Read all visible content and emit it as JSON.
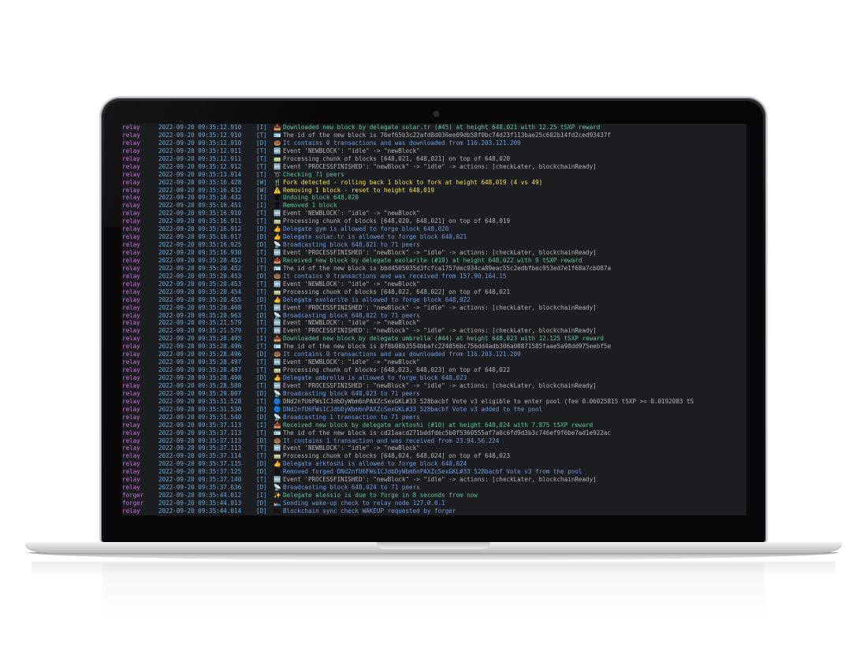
{
  "colors": {
    "process": "#c873d9",
    "timestamp": "#69a8d8",
    "msg_info": "#5fc29a",
    "msg_debug": "#6b9be0",
    "msg_trace": "#b0b3b8",
    "msg_warn": "#f1e05a"
  },
  "log_lines": [
    {
      "proc": "relay",
      "ts": "2022-09-20 09:35:12.910",
      "lvl": "[I]",
      "icon": "📥",
      "msg": "Downloaded new block by delegate solar.tr (#45) at height 648,021 with 12.25 tSXP reward",
      "color": "#5fc29a"
    },
    {
      "proc": "relay",
      "ts": "2022-09-20 09:35:12.910",
      "lvl": "[T]",
      "icon": "🪪",
      "msg": "The id of the new block is 76ef65b3c22afd8d036ee09db58f0bc74d23f113bae25c602b14fd2ced93437f",
      "color": "#b0b3b8"
    },
    {
      "proc": "relay",
      "ts": "2022-09-20 09:35:12.910",
      "lvl": "[D]",
      "icon": "🍩",
      "msg": "It contains 0 transactions and was downloaded from 116.203.121.209",
      "color": "#6b9be0"
    },
    {
      "proc": "relay",
      "ts": "2022-09-20 09:35:12.911",
      "lvl": "[T]",
      "icon": "🆕",
      "msg": "Event 'NEWBLOCK': \"idle\" -> \"newBlock\"",
      "color": "#b0b3b8"
    },
    {
      "proc": "relay",
      "ts": "2022-09-20 09:35:12.911",
      "lvl": "[T]",
      "icon": "🚃",
      "msg": "Processing chunk of blocks [648,021, 648,021] on top of 648,020",
      "color": "#b0b3b8"
    },
    {
      "proc": "relay",
      "ts": "2022-09-20 09:35:12.912",
      "lvl": "[T]",
      "icon": "🆕",
      "msg": "Event 'PROCESSFINISHED': \"newBlock\" -> \"idle\" -> actions: [checkLater, blockchainReady]",
      "color": "#b0b3b8"
    },
    {
      "proc": "relay",
      "ts": "2022-09-20 09:35:13.914",
      "lvl": "[T]",
      "icon": "➰",
      "msg": "Checking 71 peers",
      "color": "#5fc29a"
    },
    {
      "proc": "relay",
      "ts": "2022-09-20 09:35:16.428",
      "lvl": "[W]",
      "icon": "🍴",
      "msg": "Fork detected - rolling back 1 block to fork at height 648,019 (4 vs 49)",
      "color": "#f1e05a"
    },
    {
      "proc": "relay",
      "ts": "2022-09-20 09:35:16.432",
      "lvl": "[W]",
      "icon": "⚠️",
      "msg": "Removing 1 block - reset to height 648,019",
      "color": "#f1e05a"
    },
    {
      "proc": "relay",
      "ts": "2022-09-20 09:35:16.432",
      "lvl": "[I]",
      "icon": "🗑",
      "msg": "Undoing block 648,020",
      "color": "#5fc29a"
    },
    {
      "proc": "relay",
      "ts": "2022-09-20 09:35:16.451",
      "lvl": "[I]",
      "icon": "🗑",
      "msg": "Removed 1 block",
      "color": "#5fc29a"
    },
    {
      "proc": "relay",
      "ts": "2022-09-20 09:35:16.910",
      "lvl": "[T]",
      "icon": "🆕",
      "msg": "Event 'NEWBLOCK': \"idle\" -> \"newBlock\"",
      "color": "#b0b3b8"
    },
    {
      "proc": "relay",
      "ts": "2022-09-20 09:35:16.911",
      "lvl": "[T]",
      "icon": "🚃",
      "msg": "Processing chunk of blocks [648,020, 648,021] on top of 648,019",
      "color": "#b0b3b8"
    },
    {
      "proc": "relay",
      "ts": "2022-09-20 09:35:16.912",
      "lvl": "[D]",
      "icon": "👍",
      "msg": "Delegate gym is allowed to forge block 648,020",
      "color": "#6b9be0"
    },
    {
      "proc": "relay",
      "ts": "2022-09-20 09:35:16.917",
      "lvl": "[D]",
      "icon": "👍",
      "msg": "Delegate solar.tr is allowed to forge block 648,021",
      "color": "#6b9be0"
    },
    {
      "proc": "relay",
      "ts": "2022-09-20 09:35:16.925",
      "lvl": "[D]",
      "icon": "📡",
      "msg": "Broadcasting block 648,021 to 71 peers",
      "color": "#6b9be0"
    },
    {
      "proc": "relay",
      "ts": "2022-09-20 09:35:16.930",
      "lvl": "[T]",
      "icon": "🆕",
      "msg": "Event 'PROCESSFINISHED': \"newBlock\" -> \"idle\" -> actions: [checkLater, blockchainReady]",
      "color": "#b0b3b8"
    },
    {
      "proc": "relay",
      "ts": "2022-09-20 09:35:20.452",
      "lvl": "[I]",
      "icon": "📥",
      "msg": "Received new block by delegate exolarite (#19) at height 648,022 with 9 tSXP reward",
      "color": "#5fc29a"
    },
    {
      "proc": "relay",
      "ts": "2022-09-20 09:35:20.452",
      "lvl": "[T]",
      "icon": "🪪",
      "msg": "The id of the new block is bbd4505035d3fcfca1757dec934ca89eac55c2edbfbec953ed7e1f68a7cb087a",
      "color": "#b0b3b8"
    },
    {
      "proc": "relay",
      "ts": "2022-09-20 09:35:20.453",
      "lvl": "[D]",
      "icon": "🍩",
      "msg": "It contains 0 transactions and was received from 157.90.164.15",
      "color": "#6b9be0"
    },
    {
      "proc": "relay",
      "ts": "2022-09-20 09:35:20.453",
      "lvl": "[T]",
      "icon": "🆕",
      "msg": "Event 'NEWBLOCK': \"idle\" -> \"newBlock\"",
      "color": "#b0b3b8"
    },
    {
      "proc": "relay",
      "ts": "2022-09-20 09:35:20.454",
      "lvl": "[T]",
      "icon": "🚃",
      "msg": "Processing chunk of blocks [648,022, 648,022] on top of 648,021",
      "color": "#b0b3b8"
    },
    {
      "proc": "relay",
      "ts": "2022-09-20 09:35:20.455",
      "lvl": "[D]",
      "icon": "👍",
      "msg": "Delegate exolarite is allowed to forge block 648,022",
      "color": "#6b9be0"
    },
    {
      "proc": "relay",
      "ts": "2022-09-20 09:35:20.468",
      "lvl": "[T]",
      "icon": "🆕",
      "msg": "Event 'PROCESSFINISHED': \"newBlock\" -> \"idle\" -> actions: [checkLater, blockchainReady]",
      "color": "#b0b3b8"
    },
    {
      "proc": "relay",
      "ts": "2022-09-20 09:35:20.963",
      "lvl": "[D]",
      "icon": "📡",
      "msg": "Broadcasting block 648,022 to 71 peers",
      "color": "#6b9be0"
    },
    {
      "proc": "relay",
      "ts": "2022-09-20 09:35:21.579",
      "lvl": "[T]",
      "icon": "🆕",
      "msg": "Event 'NEWBLOCK': \"idle\" -> \"newBlock\"",
      "color": "#b0b3b8"
    },
    {
      "proc": "relay",
      "ts": "2022-09-20 09:35:21.579",
      "lvl": "[T]",
      "icon": "🆕",
      "msg": "Event 'PROCESSFINISHED': \"newBlock\" -> \"idle\" -> actions: [checkLater, blockchainReady]",
      "color": "#b0b3b8"
    },
    {
      "proc": "relay",
      "ts": "2022-09-20 09:35:28.495",
      "lvl": "[I]",
      "icon": "📥",
      "msg": "Downloaded new block by delegate umbrella (#44) at height 648,023 with 12.125 tSXP reward",
      "color": "#5fc29a"
    },
    {
      "proc": "relay",
      "ts": "2022-09-20 09:35:28.496",
      "lvl": "[T]",
      "icon": "🪪",
      "msg": "The id of the new block is 0f8b08b3554bbafc224056bc756dd4adb306a00871585faae5a98dd975eebf5e",
      "color": "#b0b3b8"
    },
    {
      "proc": "relay",
      "ts": "2022-09-20 09:35:28.496",
      "lvl": "[D]",
      "icon": "🍩",
      "msg": "It contains 0 transactions and was downloaded from 116.203.121.209",
      "color": "#6b9be0"
    },
    {
      "proc": "relay",
      "ts": "2022-09-20 09:35:28.497",
      "lvl": "[T]",
      "icon": "🆕",
      "msg": "Event 'NEWBLOCK': \"idle\" -> \"newBlock\"",
      "color": "#b0b3b8"
    },
    {
      "proc": "relay",
      "ts": "2022-09-20 09:35:28.497",
      "lvl": "[T]",
      "icon": "🚃",
      "msg": "Processing chunk of blocks [648,023, 648,023] on top of 648,022",
      "color": "#b0b3b8"
    },
    {
      "proc": "relay",
      "ts": "2022-09-20 09:35:28.498",
      "lvl": "[D]",
      "icon": "👍",
      "msg": "Delegate umbrella is allowed to forge block 648,023",
      "color": "#6b9be0"
    },
    {
      "proc": "relay",
      "ts": "2022-09-20 09:35:28.509",
      "lvl": "[T]",
      "icon": "🆕",
      "msg": "Event 'PROCESSFINISHED': \"newBlock\" -> \"idle\" -> actions: [checkLater, blockchainReady]",
      "color": "#b0b3b8"
    },
    {
      "proc": "relay",
      "ts": "2022-09-20 09:35:29.007",
      "lvl": "[D]",
      "icon": "📡",
      "msg": "Broadcasting block 648,023 to 71 peers",
      "color": "#6b9be0"
    },
    {
      "proc": "relay",
      "ts": "2022-09-20 09:35:31.528",
      "lvl": "[T]",
      "icon": "🔵",
      "msg": "DNd2nfU6FWs1CJdbDyWbm6nPAXZcSexGKL#33 528bacbf Vote v3 eligible to enter pool (fee 0.06025815 tSXP >= 0.0192083 tS",
      "color": "#b0b3b8"
    },
    {
      "proc": "relay",
      "ts": "2022-09-20 09:35:31.530",
      "lvl": "[D]",
      "icon": "🔵",
      "msg": "DNd2nfU6FWs1CJdbDyWbm6nPAXZcSexGKL#33 528bacbf Vote v3 added to the pool",
      "color": "#6b9be0"
    },
    {
      "proc": "relay",
      "ts": "2022-09-20 09:35:31.540",
      "lvl": "[D]",
      "icon": "📡",
      "msg": "Broadcasting 1 transaction to 71 peers",
      "color": "#6b9be0"
    },
    {
      "proc": "relay",
      "ts": "2022-09-20 09:35:37.113",
      "lvl": "[I]",
      "icon": "📥",
      "msg": "Received new block by delegate arktoshi (#10) at height 648,024 with 7.875 tSXP reward",
      "color": "#5fc29a"
    },
    {
      "proc": "relay",
      "ts": "2022-09-20 09:35:37.113",
      "lvl": "[T]",
      "icon": "🪪",
      "msg": "The id of the new block is cd21aacd271bddfdec5b0f5360555af7a0c6fd9d3b3c746ef9f6be7ad1e922ac",
      "color": "#b0b3b8"
    },
    {
      "proc": "relay",
      "ts": "2022-09-20 09:35:37.113",
      "lvl": "[D]",
      "icon": "🍩",
      "msg": "It contains 1 transaction and was received from 23.94.56.224",
      "color": "#6b9be0"
    },
    {
      "proc": "relay",
      "ts": "2022-09-20 09:35:37.113",
      "lvl": "[T]",
      "icon": "🆕",
      "msg": "Event 'NEWBLOCK': \"idle\" -> \"newBlock\"",
      "color": "#b0b3b8"
    },
    {
      "proc": "relay",
      "ts": "2022-09-20 09:35:37.114",
      "lvl": "[T]",
      "icon": "🚃",
      "msg": "Processing chunk of blocks [648,024, 648,024] on top of 648,023",
      "color": "#b0b3b8"
    },
    {
      "proc": "relay",
      "ts": "2022-09-20 09:35:37.115",
      "lvl": "[D]",
      "icon": "👍",
      "msg": "Delegate arktoshi is allowed to forge block 648,024",
      "color": "#6b9be0"
    },
    {
      "proc": "relay",
      "ts": "2022-09-20 09:35:37.125",
      "lvl": "[D]",
      "icon": "🗒",
      "msg": "Removed forged DNd2nfU6FWs1CJdbDyWbm6nPAXZcSexGKL#33 528bacbf Vote v3 from the pool",
      "color": "#6b9be0"
    },
    {
      "proc": "relay",
      "ts": "2022-09-20 09:35:37.140",
      "lvl": "[T]",
      "icon": "🆕",
      "msg": "Event 'PROCESSFINISHED': \"newBlock\" -> \"idle\" -> actions: [checkLater, blockchainReady]",
      "color": "#b0b3b8"
    },
    {
      "proc": "relay",
      "ts": "2022-09-20 09:35:37.636",
      "lvl": "[D]",
      "icon": "📡",
      "msg": "Broadcasting block 648,024 to 71 peers",
      "color": "#6b9be0"
    },
    {
      "proc": "forger",
      "ts": "2022-09-20 09:35:44.012",
      "lvl": "[I]",
      "icon": "✨",
      "msg": "Delegate alessio is due to forge in 8 seconds from now",
      "color": "#5fc29a"
    },
    {
      "proc": "forger",
      "ts": "2022-09-20 09:35:44.013",
      "lvl": "[D]",
      "icon": "🛌",
      "msg": "Sending wake-up check to relay node 127.0.0.1",
      "color": "#6b9be0"
    },
    {
      "proc": "relay",
      "ts": "2022-09-20 09:35:44.014",
      "lvl": "[D]",
      "icon": "🛏",
      "msg": "Blockchain sync check WAKEUP requested by forger",
      "color": "#6b9be0"
    }
  ]
}
